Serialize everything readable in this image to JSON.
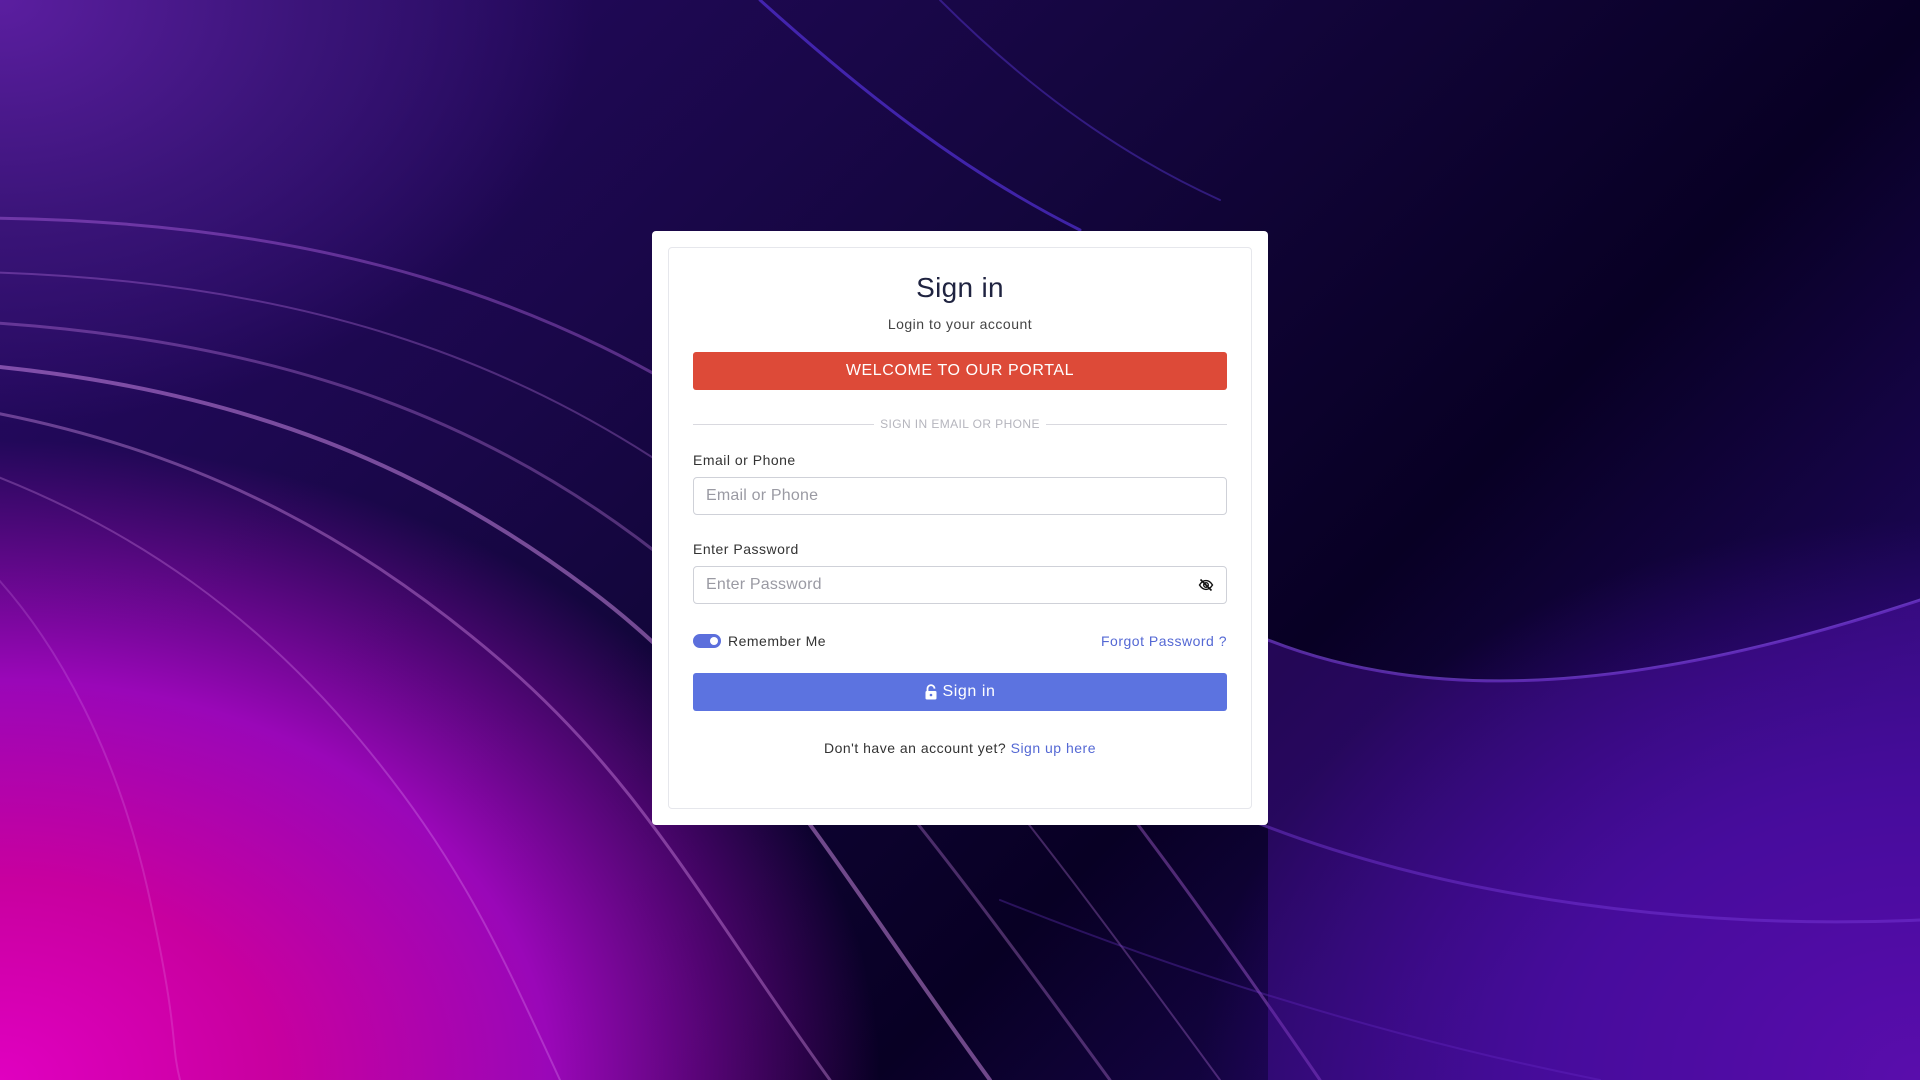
{
  "page": {
    "title": "Sign in",
    "subtitle": "Login to your account"
  },
  "banner": {
    "text": "WELCOME TO OUR PORTAL",
    "color": "#dd4a38"
  },
  "divider": {
    "text": "SIGN IN EMAIL OR PHONE"
  },
  "form": {
    "email_label": "Email or Phone",
    "email_placeholder": "Email or Phone",
    "email_value": "",
    "password_label": "Enter Password",
    "password_placeholder": "Enter Password",
    "password_value": "",
    "password_visibility_icon": "eye-slash-icon",
    "remember_label": "Remember Me",
    "remember_checked": true,
    "forgot_label": "Forgot Password ?",
    "submit_label": "Sign in",
    "submit_icon": "lock-icon",
    "accent": "#5c73e0"
  },
  "footer": {
    "prompt": "Don't have an account yet?",
    "signup_link": "Sign up here"
  }
}
